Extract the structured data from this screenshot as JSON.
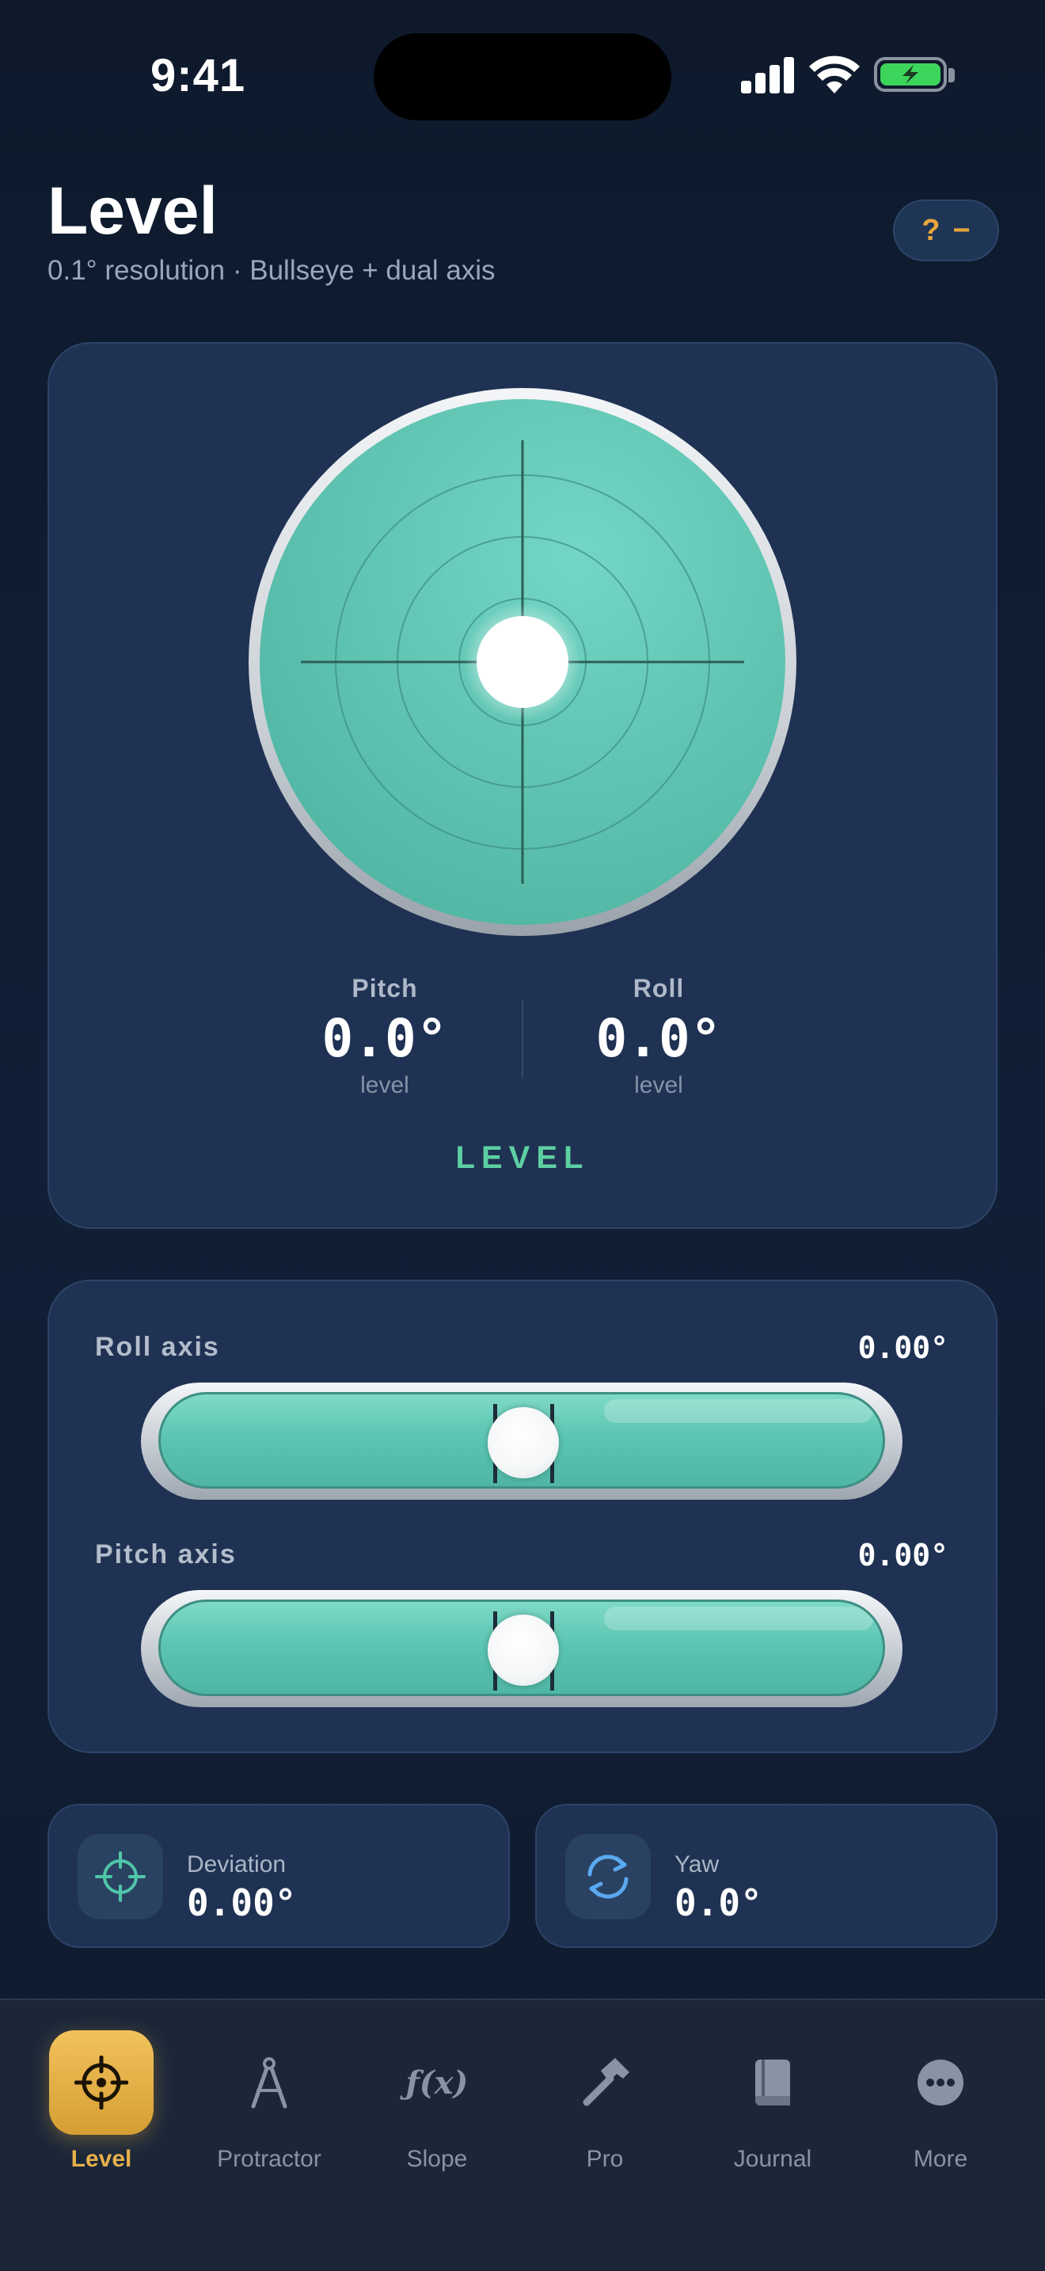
{
  "status_bar": {
    "time": "9:41"
  },
  "header": {
    "title": "Level",
    "subtitle": "0.1° resolution · Bullseye + dual axis",
    "help_question": "?",
    "help_dash": "−"
  },
  "colors": {
    "accent": "#e8b04a",
    "level_green": "#5dd0a2",
    "vial": "#5cc6b2",
    "card": "#1f3253"
  },
  "bullseye": {
    "pitch_label": "Pitch",
    "pitch_value": "0.0°",
    "pitch_state": "level",
    "roll_label": "Roll",
    "roll_value": "0.0°",
    "roll_state": "level",
    "status": "LEVEL"
  },
  "axes": {
    "roll_label": "Roll axis",
    "roll_value": "0.00°",
    "pitch_label": "Pitch axis",
    "pitch_value": "0.00°"
  },
  "metrics": {
    "deviation_icon": "crosshair-icon",
    "deviation_label": "Deviation",
    "deviation_value": "0.00°",
    "yaw_icon": "rotate-icon",
    "yaw_label": "Yaw",
    "yaw_value": "0.0°"
  },
  "tabs": [
    {
      "label": "Level",
      "icon": "crosshair-icon",
      "active": true
    },
    {
      "label": "Protractor",
      "icon": "compass-icon",
      "active": false
    },
    {
      "label": "Slope",
      "icon": "function-icon",
      "active": false
    },
    {
      "label": "Pro",
      "icon": "hammer-icon",
      "active": false
    },
    {
      "label": "Journal",
      "icon": "book-icon",
      "active": false
    },
    {
      "label": "More",
      "icon": "more-icon",
      "active": false
    }
  ]
}
